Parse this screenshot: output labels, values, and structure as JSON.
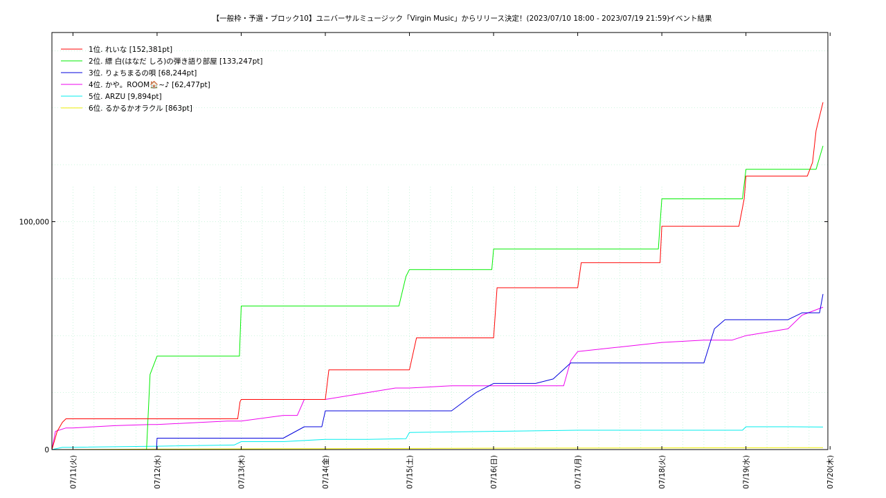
{
  "chart_data": {
    "type": "line",
    "title": "【一般枠・予選・ブロック10】ユニバーサルミュージック「Virgin Music」からリリース決定！(2023/07/10 18:00 - 2023/07/19 21:59)",
    "subtitle": "イベント結果",
    "xlabel": "",
    "ylabel": "",
    "x_range": [
      "2023-07-10 18:00",
      "2023-07-19 21:59"
    ],
    "x_ticks": [
      {
        "date": "2023-07-11 00:00",
        "label": "07/11(火)"
      },
      {
        "date": "2023-07-12 00:00",
        "label": "07/12(水)"
      },
      {
        "date": "2023-07-13 00:00",
        "label": "07/13(木)"
      },
      {
        "date": "2023-07-14 00:00",
        "label": "07/14(金)"
      },
      {
        "date": "2023-07-15 00:00",
        "label": "07/15(土)"
      },
      {
        "date": "2023-07-16 00:00",
        "label": "07/16(日)"
      },
      {
        "date": "2023-07-17 00:00",
        "label": "07/17(月)"
      },
      {
        "date": "2023-07-18 00:00",
        "label": "07/18(火)"
      },
      {
        "date": "2023-07-19 00:00",
        "label": "07/19(水)"
      },
      {
        "date": "2023-07-20 00:00",
        "label": "07/20(木)"
      }
    ],
    "ylim": [
      0,
      183000
    ],
    "y_ticks": [
      {
        "value": 0,
        "label": "0"
      },
      {
        "value": 100000,
        "label": "100,000"
      }
    ],
    "grid": true,
    "legend_position": "top-left",
    "series": [
      {
        "name": "1位. れいな [152,381pt]",
        "color": "#ff0000",
        "x": [
          "2023-07-10 18:00",
          "2023-07-10 19:30",
          "2023-07-10 21:00",
          "2023-07-10 22:00",
          "2023-07-11 00:00",
          "2023-07-12 00:00",
          "2023-07-12 23:00",
          "2023-07-12 23:40",
          "2023-07-13 00:00",
          "2023-07-13 12:00",
          "2023-07-14 00:00",
          "2023-07-14 01:00",
          "2023-07-14 12:00",
          "2023-07-15 00:00",
          "2023-07-15 02:00",
          "2023-07-15 12:00",
          "2023-07-16 00:00",
          "2023-07-16 01:00",
          "2023-07-16 12:00",
          "2023-07-17 00:00",
          "2023-07-17 01:00",
          "2023-07-17 12:00",
          "2023-07-17 23:30",
          "2023-07-18 00:00",
          "2023-07-18 12:00",
          "2023-07-18 22:00",
          "2023-07-18 23:30",
          "2023-07-19 00:00",
          "2023-07-19 12:00",
          "2023-07-19 17:30",
          "2023-07-19 19:00",
          "2023-07-19 20:00",
          "2023-07-19 21:59"
        ],
        "values": [
          0,
          8000,
          12000,
          13500,
          13500,
          13500,
          13500,
          21000,
          22000,
          22000,
          22000,
          35000,
          35000,
          35000,
          49000,
          49000,
          49000,
          71000,
          71000,
          71000,
          82000,
          82000,
          82000,
          98000,
          98000,
          98000,
          110000,
          120000,
          120000,
          120000,
          126000,
          140000,
          152381
        ]
      },
      {
        "name": "2位. 縹 白(はなだ しろ)の弾き語り部屋 [133,247pt]",
        "color": "#00ee00",
        "x": [
          "2023-07-10 18:00",
          "2023-07-11 00:00",
          "2023-07-11 21:00",
          "2023-07-11 22:00",
          "2023-07-12 00:00",
          "2023-07-12 12:00",
          "2023-07-12 23:30",
          "2023-07-13 00:00",
          "2023-07-14 00:00",
          "2023-07-14 21:00",
          "2023-07-14 23:00",
          "2023-07-15 00:00",
          "2023-07-15 12:00",
          "2023-07-15 23:30",
          "2023-07-16 00:00",
          "2023-07-16 12:00",
          "2023-07-17 00:00",
          "2023-07-17 12:00",
          "2023-07-17 23:00",
          "2023-07-18 00:00",
          "2023-07-18 12:00",
          "2023-07-18 23:00",
          "2023-07-19 00:00",
          "2023-07-19 12:00",
          "2023-07-19 20:00",
          "2023-07-19 21:59"
        ],
        "values": [
          0,
          0,
          0,
          33000,
          41000,
          41000,
          41000,
          63000,
          63000,
          63000,
          76000,
          79000,
          79000,
          79000,
          88000,
          88000,
          88000,
          88000,
          88000,
          110000,
          110000,
          110000,
          123000,
          123000,
          123000,
          133247
        ]
      },
      {
        "name": "3位. りょちまるの唄 [68,244pt]",
        "color": "#0000dd",
        "x": [
          "2023-07-10 18:00",
          "2023-07-11 00:00",
          "2023-07-11 23:50",
          "2023-07-12 00:00",
          "2023-07-13 12:00",
          "2023-07-13 18:00",
          "2023-07-13 23:00",
          "2023-07-14 00:00",
          "2023-07-15 12:00",
          "2023-07-15 19:00",
          "2023-07-16 00:00",
          "2023-07-16 12:00",
          "2023-07-16 17:00",
          "2023-07-16 22:00",
          "2023-07-17 00:00",
          "2023-07-17 12:00",
          "2023-07-18 12:00",
          "2023-07-18 15:00",
          "2023-07-18 18:00",
          "2023-07-19 00:00",
          "2023-07-19 12:00",
          "2023-07-19 16:00",
          "2023-07-19 21:00",
          "2023-07-19 21:59"
        ],
        "values": [
          0,
          0,
          0,
          5000,
          5000,
          10000,
          10000,
          17000,
          17000,
          25000,
          29000,
          29000,
          31000,
          38000,
          38000,
          38000,
          38000,
          53000,
          57000,
          57000,
          57000,
          60000,
          60000,
          68244
        ]
      },
      {
        "name": "4位. かや。ROOM🏠~♪ [62,477pt]",
        "color": "#ee00ee",
        "x": [
          "2023-07-10 18:00",
          "2023-07-10 19:00",
          "2023-07-10 22:00",
          "2023-07-11 00:00",
          "2023-07-11 12:00",
          "2023-07-11 22:00",
          "2023-07-12 00:00",
          "2023-07-12 20:00",
          "2023-07-13 00:00",
          "2023-07-13 12:00",
          "2023-07-13 16:00",
          "2023-07-13 18:00",
          "2023-07-14 00:00",
          "2023-07-14 12:00",
          "2023-07-14 20:00",
          "2023-07-15 00:00",
          "2023-07-15 12:00",
          "2023-07-16 00:00",
          "2023-07-16 20:00",
          "2023-07-16 22:00",
          "2023-07-17 00:00",
          "2023-07-17 12:00",
          "2023-07-18 00:00",
          "2023-07-18 12:00",
          "2023-07-18 20:00",
          "2023-07-19 00:00",
          "2023-07-19 12:00",
          "2023-07-19 16:00",
          "2023-07-19 21:59"
        ],
        "values": [
          0,
          8000,
          9500,
          9500,
          10500,
          11000,
          11000,
          12500,
          12500,
          15000,
          15000,
          22000,
          22000,
          25000,
          27000,
          27000,
          28000,
          28000,
          28000,
          39000,
          43000,
          45000,
          47000,
          48000,
          48000,
          50000,
          53000,
          59000,
          62477
        ]
      },
      {
        "name": "5位. ARZU [9,894pt]",
        "color": "#00eeee",
        "x": [
          "2023-07-10 18:00",
          "2023-07-10 21:00",
          "2023-07-11 00:00",
          "2023-07-12 00:00",
          "2023-07-12 22:00",
          "2023-07-13 00:00",
          "2023-07-13 12:00",
          "2023-07-14 00:00",
          "2023-07-14 12:00",
          "2023-07-14 23:00",
          "2023-07-15 00:00",
          "2023-07-16 00:00",
          "2023-07-17 00:00",
          "2023-07-17 12:00",
          "2023-07-18 12:00",
          "2023-07-18 23:00",
          "2023-07-19 00:00",
          "2023-07-19 12:00",
          "2023-07-19 21:59"
        ],
        "values": [
          0,
          1000,
          1000,
          1500,
          2000,
          3500,
          3500,
          4500,
          4500,
          4800,
          7500,
          8000,
          8500,
          8500,
          8500,
          8500,
          10000,
          10000,
          9894
        ]
      },
      {
        "name": "6位. るかるかオラクル [863pt]",
        "color": "#eeee00",
        "x": [
          "2023-07-10 18:00",
          "2023-07-12 00:00",
          "2023-07-14 00:00",
          "2023-07-16 00:00",
          "2023-07-19 21:59"
        ],
        "values": [
          0,
          200,
          400,
          600,
          863
        ]
      }
    ]
  }
}
